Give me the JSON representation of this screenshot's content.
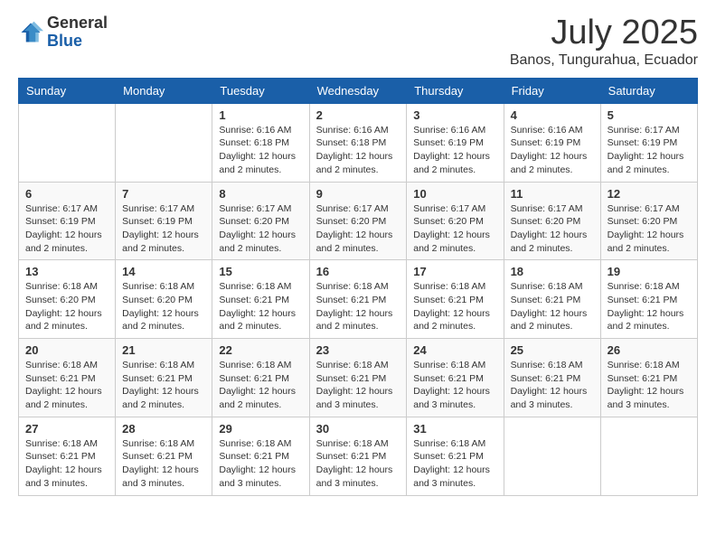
{
  "header": {
    "logo_general": "General",
    "logo_blue": "Blue",
    "month": "July 2025",
    "location": "Banos, Tungurahua, Ecuador"
  },
  "days_of_week": [
    "Sunday",
    "Monday",
    "Tuesday",
    "Wednesday",
    "Thursday",
    "Friday",
    "Saturday"
  ],
  "weeks": [
    [
      {
        "day": "",
        "info": ""
      },
      {
        "day": "",
        "info": ""
      },
      {
        "day": "1",
        "info": "Sunrise: 6:16 AM\nSunset: 6:18 PM\nDaylight: 12 hours and 2 minutes."
      },
      {
        "day": "2",
        "info": "Sunrise: 6:16 AM\nSunset: 6:18 PM\nDaylight: 12 hours and 2 minutes."
      },
      {
        "day": "3",
        "info": "Sunrise: 6:16 AM\nSunset: 6:19 PM\nDaylight: 12 hours and 2 minutes."
      },
      {
        "day": "4",
        "info": "Sunrise: 6:16 AM\nSunset: 6:19 PM\nDaylight: 12 hours and 2 minutes."
      },
      {
        "day": "5",
        "info": "Sunrise: 6:17 AM\nSunset: 6:19 PM\nDaylight: 12 hours and 2 minutes."
      }
    ],
    [
      {
        "day": "6",
        "info": "Sunrise: 6:17 AM\nSunset: 6:19 PM\nDaylight: 12 hours and 2 minutes."
      },
      {
        "day": "7",
        "info": "Sunrise: 6:17 AM\nSunset: 6:19 PM\nDaylight: 12 hours and 2 minutes."
      },
      {
        "day": "8",
        "info": "Sunrise: 6:17 AM\nSunset: 6:20 PM\nDaylight: 12 hours and 2 minutes."
      },
      {
        "day": "9",
        "info": "Sunrise: 6:17 AM\nSunset: 6:20 PM\nDaylight: 12 hours and 2 minutes."
      },
      {
        "day": "10",
        "info": "Sunrise: 6:17 AM\nSunset: 6:20 PM\nDaylight: 12 hours and 2 minutes."
      },
      {
        "day": "11",
        "info": "Sunrise: 6:17 AM\nSunset: 6:20 PM\nDaylight: 12 hours and 2 minutes."
      },
      {
        "day": "12",
        "info": "Sunrise: 6:17 AM\nSunset: 6:20 PM\nDaylight: 12 hours and 2 minutes."
      }
    ],
    [
      {
        "day": "13",
        "info": "Sunrise: 6:18 AM\nSunset: 6:20 PM\nDaylight: 12 hours and 2 minutes."
      },
      {
        "day": "14",
        "info": "Sunrise: 6:18 AM\nSunset: 6:20 PM\nDaylight: 12 hours and 2 minutes."
      },
      {
        "day": "15",
        "info": "Sunrise: 6:18 AM\nSunset: 6:21 PM\nDaylight: 12 hours and 2 minutes."
      },
      {
        "day": "16",
        "info": "Sunrise: 6:18 AM\nSunset: 6:21 PM\nDaylight: 12 hours and 2 minutes."
      },
      {
        "day": "17",
        "info": "Sunrise: 6:18 AM\nSunset: 6:21 PM\nDaylight: 12 hours and 2 minutes."
      },
      {
        "day": "18",
        "info": "Sunrise: 6:18 AM\nSunset: 6:21 PM\nDaylight: 12 hours and 2 minutes."
      },
      {
        "day": "19",
        "info": "Sunrise: 6:18 AM\nSunset: 6:21 PM\nDaylight: 12 hours and 2 minutes."
      }
    ],
    [
      {
        "day": "20",
        "info": "Sunrise: 6:18 AM\nSunset: 6:21 PM\nDaylight: 12 hours and 2 minutes."
      },
      {
        "day": "21",
        "info": "Sunrise: 6:18 AM\nSunset: 6:21 PM\nDaylight: 12 hours and 2 minutes."
      },
      {
        "day": "22",
        "info": "Sunrise: 6:18 AM\nSunset: 6:21 PM\nDaylight: 12 hours and 2 minutes."
      },
      {
        "day": "23",
        "info": "Sunrise: 6:18 AM\nSunset: 6:21 PM\nDaylight: 12 hours and 3 minutes."
      },
      {
        "day": "24",
        "info": "Sunrise: 6:18 AM\nSunset: 6:21 PM\nDaylight: 12 hours and 3 minutes."
      },
      {
        "day": "25",
        "info": "Sunrise: 6:18 AM\nSunset: 6:21 PM\nDaylight: 12 hours and 3 minutes."
      },
      {
        "day": "26",
        "info": "Sunrise: 6:18 AM\nSunset: 6:21 PM\nDaylight: 12 hours and 3 minutes."
      }
    ],
    [
      {
        "day": "27",
        "info": "Sunrise: 6:18 AM\nSunset: 6:21 PM\nDaylight: 12 hours and 3 minutes."
      },
      {
        "day": "28",
        "info": "Sunrise: 6:18 AM\nSunset: 6:21 PM\nDaylight: 12 hours and 3 minutes."
      },
      {
        "day": "29",
        "info": "Sunrise: 6:18 AM\nSunset: 6:21 PM\nDaylight: 12 hours and 3 minutes."
      },
      {
        "day": "30",
        "info": "Sunrise: 6:18 AM\nSunset: 6:21 PM\nDaylight: 12 hours and 3 minutes."
      },
      {
        "day": "31",
        "info": "Sunrise: 6:18 AM\nSunset: 6:21 PM\nDaylight: 12 hours and 3 minutes."
      },
      {
        "day": "",
        "info": ""
      },
      {
        "day": "",
        "info": ""
      }
    ]
  ]
}
